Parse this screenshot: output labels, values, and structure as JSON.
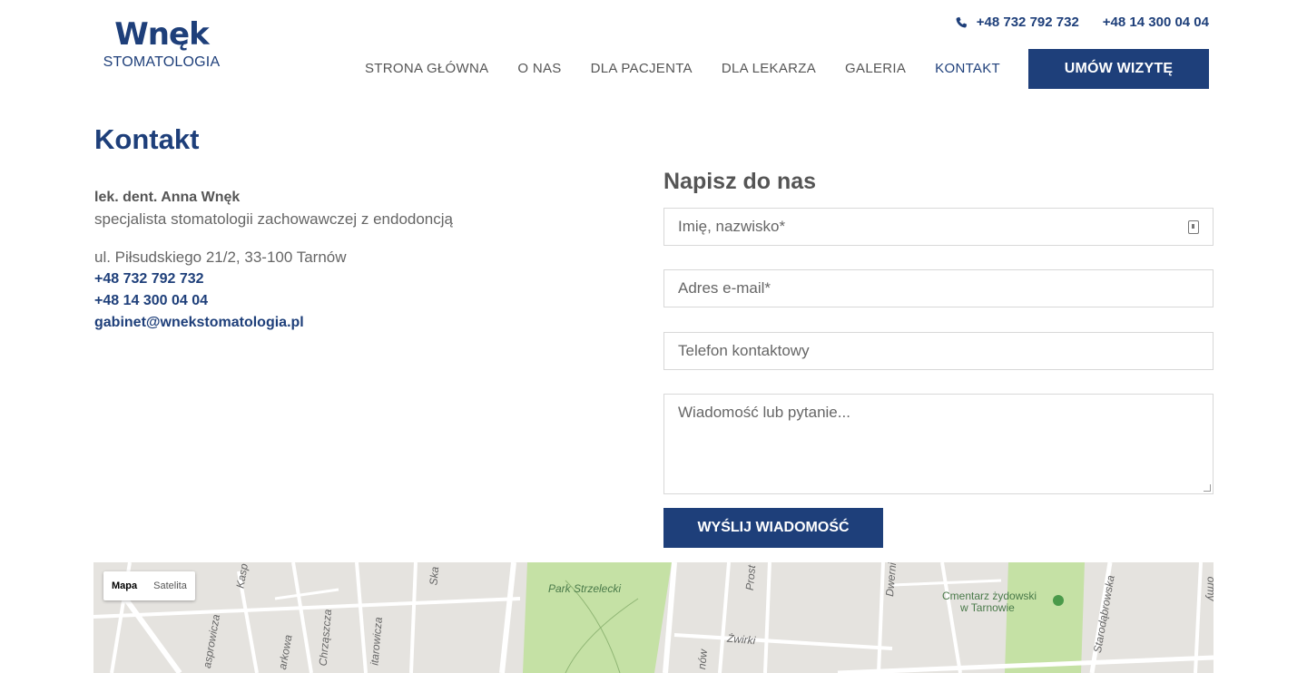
{
  "header": {
    "logo_name": "Wnęk",
    "logo_sub": "STOMATOLOGIA",
    "phones": [
      "+48 732 792 732",
      "+48 14 300 04 04"
    ],
    "nav": [
      "STRONA GŁÓWNA",
      "O NAS",
      "DLA PACJENTA",
      "DLA LEKARZA",
      "GALERIA",
      "KONTAKT"
    ],
    "active_nav": "KONTAKT",
    "cta_label": "UMÓW WIZYTĘ"
  },
  "page_title": "Kontakt",
  "contact": {
    "doctor": "lek. dent. Anna Wnęk",
    "specialty": "specjalista stomatologii zachowawczej z endodoncją",
    "address": "ul. Piłsudskiego 21/2, 33-100 Tarnów",
    "phone1": "+48 732 792 732",
    "phone2": "+48 14 300 04 04",
    "email": "gabinet@wnekstomatologia.pl"
  },
  "form": {
    "title": "Napisz do nas",
    "name_placeholder": "Imię, nazwisko*",
    "email_placeholder": "Adres e-mail*",
    "phone_placeholder": "Telefon kontaktowy",
    "message_placeholder": "Wiadomość lub pytanie...",
    "submit_label": "WYŚLIJ WIADOMOŚĆ"
  },
  "map": {
    "type_map": "Mapa",
    "type_satellite": "Satelita",
    "labels": {
      "park": "Park Strzelecki",
      "cemetery_line1": "Cmentarz żydowski",
      "cemetery_line2": "w Tarnowie",
      "kasp": "Kasp",
      "kasprowicza": "asprowicza",
      "parkowa": "arkowa",
      "chrzaszcza": "Chrząszcza",
      "starowicza": "itarowicza",
      "ska": "Ska",
      "prost": "Prost",
      "zwirki": "Żwirki",
      "nowa": "nów",
      "dwerni": "Dwerni",
      "starodabrowska": "Starodąbrowska",
      "right_edge": "ormy"
    },
    "colors": {
      "land": "#e5e3df",
      "road": "#ffffff",
      "park": "#c5e1a5"
    }
  },
  "colors": {
    "brand": "#1e3f7a",
    "text": "#555555"
  }
}
